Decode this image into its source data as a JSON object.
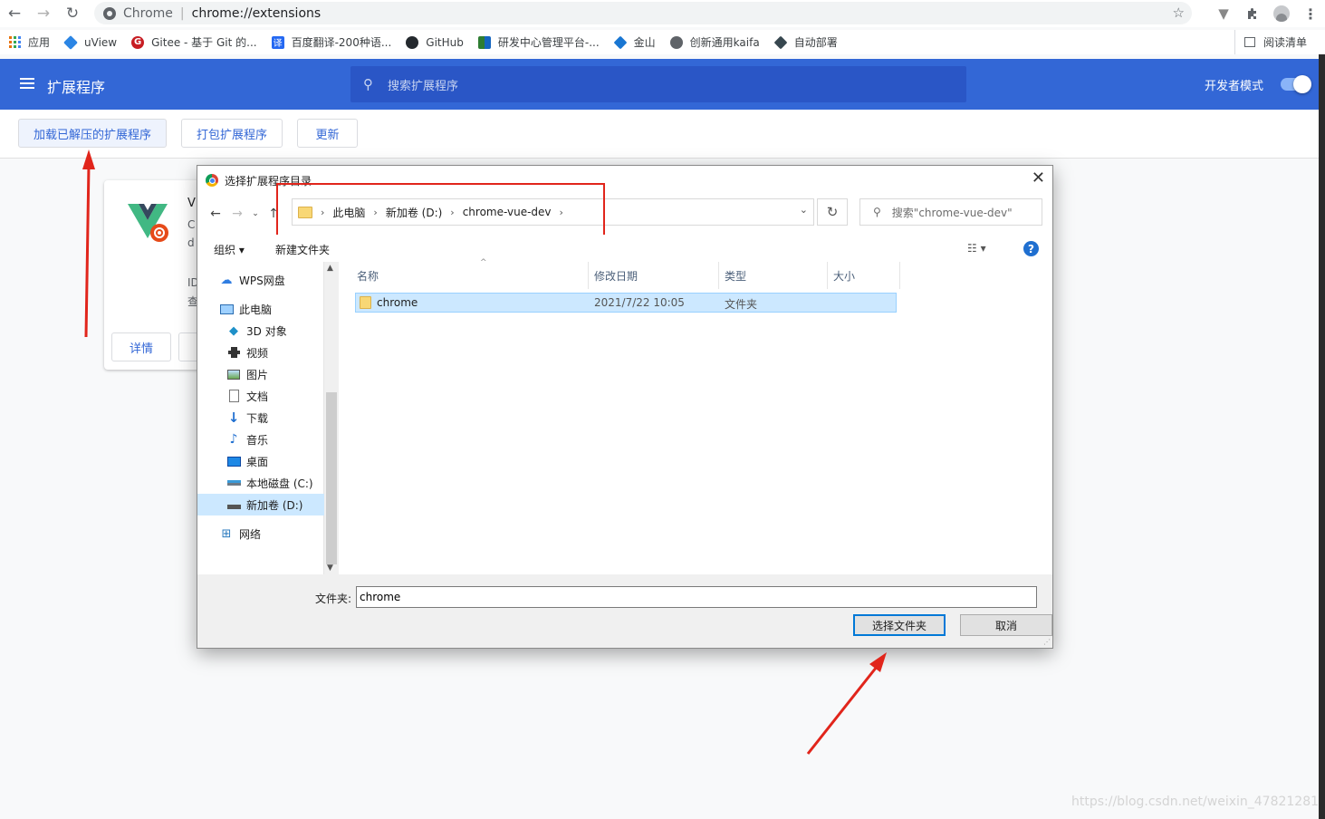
{
  "browser": {
    "omnibox": {
      "site_name": "Chrome",
      "url": "chrome://extensions"
    },
    "icons": [
      "back-icon",
      "forward-icon",
      "reload-icon",
      "site-info-icon",
      "star-icon",
      "vue-devtools-icon",
      "puzzle-icon",
      "profile-icon",
      "menu-kebab-icon"
    ]
  },
  "bookmarks": {
    "items": [
      {
        "label": "应用"
      },
      {
        "label": "uView"
      },
      {
        "label": "Gitee - 基于 Git 的..."
      },
      {
        "label": "百度翻译-200种语..."
      },
      {
        "label": "GitHub"
      },
      {
        "label": "研发中心管理平台-..."
      },
      {
        "label": "金山"
      },
      {
        "label": "创新通用kaifa"
      },
      {
        "label": "自动部署"
      }
    ],
    "reading_list": "阅读清单"
  },
  "extensions_page": {
    "title": "扩展程序",
    "search_placeholder": "搜索扩展程序",
    "dev_mode_label": "开发者模式",
    "dev_mode_on": true,
    "buttons": {
      "load_unpacked": "加载已解压的扩展程序",
      "pack": "打包扩展程序",
      "update": "更新"
    },
    "card": {
      "name_fragment": "V",
      "desc_fragment_1": "C",
      "desc_fragment_2": "d",
      "id_fragment": "ID",
      "view_fragment": "查",
      "details_button": "详情"
    },
    "colors": {
      "header": "#3367d6",
      "accent": "#3367d6"
    }
  },
  "dialog": {
    "title": "选择扩展程序目录",
    "breadcrumb": [
      "此电脑",
      "新加卷 (D:)",
      "chrome-vue-dev"
    ],
    "search_placeholder": "搜索\"chrome-vue-dev\"",
    "toolbar": {
      "organize": "组织 ▾",
      "new_folder": "新建文件夹"
    },
    "nav_items": [
      {
        "label": "WPS网盘",
        "icon": "cloud-icon"
      },
      {
        "label": "此电脑",
        "icon": "computer-icon"
      },
      {
        "label": "3D 对象",
        "icon": "cube-icon"
      },
      {
        "label": "视频",
        "icon": "video-icon"
      },
      {
        "label": "图片",
        "icon": "picture-icon"
      },
      {
        "label": "文档",
        "icon": "document-icon"
      },
      {
        "label": "下载",
        "icon": "download-icon"
      },
      {
        "label": "音乐",
        "icon": "music-icon"
      },
      {
        "label": "桌面",
        "icon": "desktop-icon"
      },
      {
        "label": "本地磁盘 (C:)",
        "icon": "drive-icon"
      },
      {
        "label": "新加卷 (D:)",
        "icon": "drive-icon",
        "selected": true
      },
      {
        "label": "网络",
        "icon": "network-icon"
      }
    ],
    "columns": [
      "名称",
      "修改日期",
      "类型",
      "大小"
    ],
    "files": [
      {
        "name": "chrome",
        "modified": "2021/7/22 10:05",
        "type": "文件夹",
        "size": ""
      }
    ],
    "folder_label": "文件夹:",
    "folder_value": "chrome",
    "select_button": "选择文件夹",
    "cancel_button": "取消",
    "annotation_color": "#e1251b"
  },
  "watermark": "https://blog.csdn.net/weixin_47821281"
}
